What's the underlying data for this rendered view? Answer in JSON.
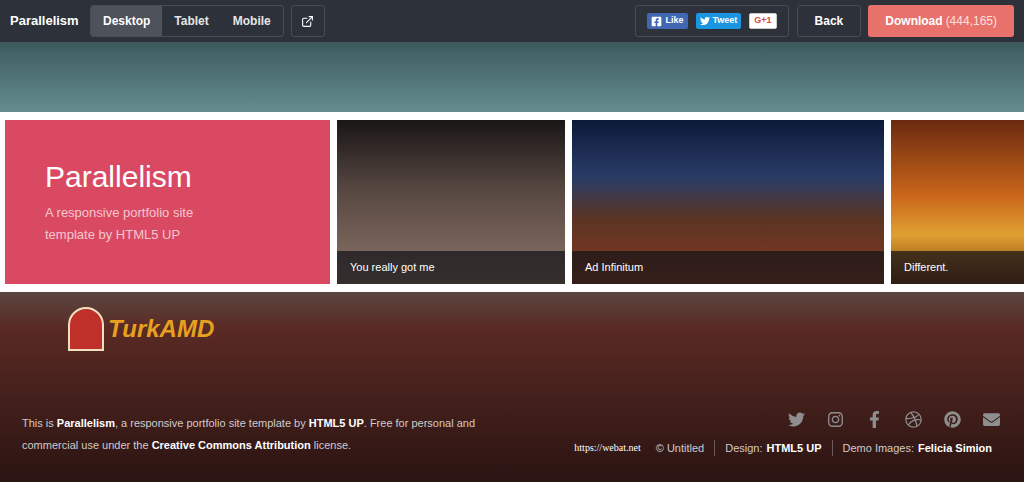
{
  "topbar": {
    "title": "Parallelism",
    "devices": [
      {
        "label": "Desktop",
        "selected": true
      },
      {
        "label": "Tablet",
        "selected": false
      },
      {
        "label": "Mobile",
        "selected": false
      }
    ],
    "social": [
      {
        "label": "Like",
        "kind": "facebook"
      },
      {
        "label": "Tweet",
        "kind": "twitter"
      },
      {
        "label": "G+1",
        "kind": "google"
      }
    ],
    "back": "Back",
    "download": {
      "label": "Download",
      "count": "(444,165)"
    }
  },
  "intro": {
    "title": "Parallelism",
    "subtitle": "A responsive portfolio site template by HTML5 UP"
  },
  "items": [
    {
      "caption": "You really got me",
      "kind": "face"
    },
    {
      "caption": "Ad Infinitum",
      "kind": "landscape"
    },
    {
      "caption": "Different.",
      "kind": "sunflowers"
    }
  ],
  "watermark": "TurkAMD",
  "footer": {
    "blurb": [
      {
        "text": "This is ",
        "bold": false
      },
      {
        "text": "Parallelism",
        "bold": true
      },
      {
        "text": ", a responsive portfolio site template by ",
        "bold": false
      },
      {
        "text": "HTML5 UP",
        "bold": true
      },
      {
        "text": ". Free for personal and commercial use under the ",
        "bold": false
      },
      {
        "text": "Creative Commons Attribution",
        "bold": true
      },
      {
        "text": " license.",
        "bold": false
      }
    ],
    "url": "https://webat.net",
    "credits": [
      {
        "label": "© Untitled",
        "value": ""
      },
      {
        "label": "Design:",
        "value": "HTML5 UP"
      },
      {
        "label": "Demo Images:",
        "value": "Felicia Simion"
      }
    ]
  }
}
